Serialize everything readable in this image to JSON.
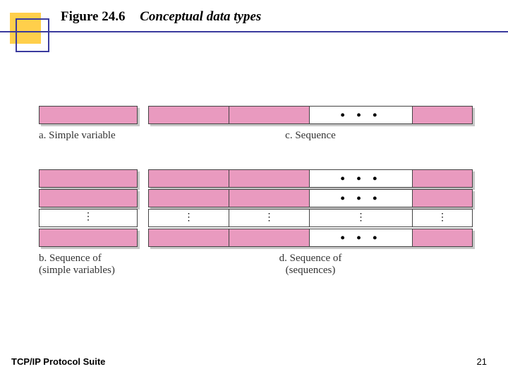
{
  "title": {
    "figure": "Figure 24.6",
    "subtitle": "Conceptual data types"
  },
  "footer": {
    "left": "TCP/IP Protocol Suite",
    "page": "21"
  },
  "diagram": {
    "a": {
      "caption": "a. Simple variable"
    },
    "b": {
      "caption": "b. Sequence of\n(simple variables)"
    },
    "c": {
      "caption": "c. Sequence"
    },
    "d": {
      "caption": "d. Sequence of\n(sequences)"
    },
    "ellipsis_h": "•  •  •",
    "ellipsis_v": "•\n•\n•"
  },
  "chart_data": {
    "type": "table",
    "title": "Conceptual data types",
    "items": [
      {
        "id": "a",
        "label": "Simple variable",
        "structure": "single cell"
      },
      {
        "id": "b",
        "label": "Sequence of (simple variables)",
        "structure": "vertical list of N simple variables"
      },
      {
        "id": "c",
        "label": "Sequence",
        "structure": "horizontal row of M fields"
      },
      {
        "id": "d",
        "label": "Sequence of (sequences)",
        "structure": "N rows, each a horizontal row of M fields"
      }
    ]
  }
}
